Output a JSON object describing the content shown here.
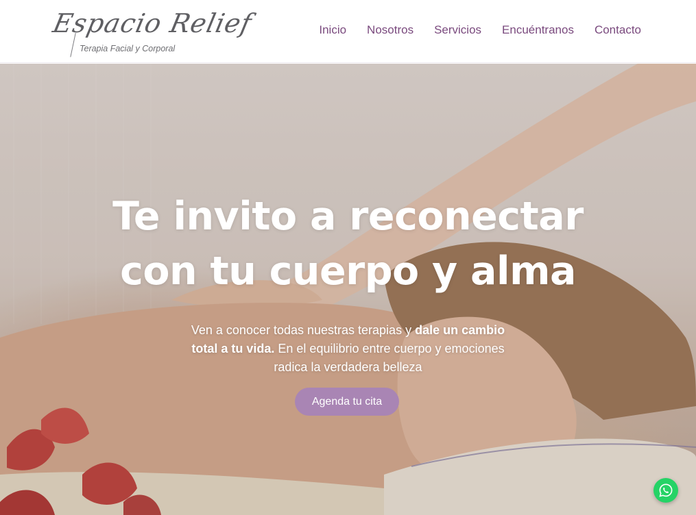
{
  "brand": {
    "name": "Espacio Relief",
    "tagline": "Terapia Facial y Corporal"
  },
  "nav": {
    "items": [
      "Inicio",
      "Nosotros",
      "Servicios",
      "Encuéntranos",
      "Contacto"
    ]
  },
  "hero": {
    "headline_line1": "Te invito a reconectar",
    "headline_line2": "con tu cuerpo y alma",
    "lead_part1": "Ven a conocer todas nuestras terapias y ",
    "lead_bold": "dale un cambio total a tu vida.",
    "lead_part2": " En el equilibrio entre cuerpo y emociones radica la verdadera belleza",
    "cta_label": "Agenda tu cita"
  },
  "icons": {
    "whatsapp": "whatsapp-icon"
  },
  "colors": {
    "nav_text": "#7a4a7e",
    "cta_bg": "#a985b4",
    "whatsapp": "#25d366"
  }
}
